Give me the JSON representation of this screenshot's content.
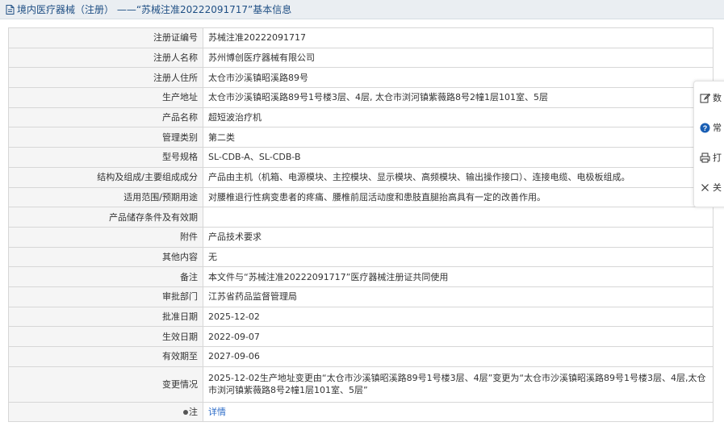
{
  "header": {
    "title": "境内医疗器械（注册） ——“苏械注准20222091717”基本信息"
  },
  "rows": [
    {
      "label": "注册证编号",
      "value": "苏械注准20222091717"
    },
    {
      "label": "注册人名称",
      "value": "苏州博创医疗器械有限公司"
    },
    {
      "label": "注册人住所",
      "value": "太仓市沙溪镇昭溪路89号"
    },
    {
      "label": "生产地址",
      "value": "太仓市沙溪镇昭溪路89号1号楼3层、4层, 太仓市浏河镇紫薇路8号2幢1层101室、5层"
    },
    {
      "label": "产品名称",
      "value": "超短波治疗机"
    },
    {
      "label": "管理类别",
      "value": "第二类"
    },
    {
      "label": "型号规格",
      "value": "SL-CDB-A、SL-CDB-B"
    },
    {
      "label": "结构及组成/主要组成成分",
      "value": "产品由主机（机箱、电源模块、主控模块、显示模块、高频模块、输出操作接口）、连接电缆、电极板组成。"
    },
    {
      "label": "适用范围/预期用途",
      "value": "对腰椎退行性病变患者的疼痛、腰椎前屈活动度和患肢直腿抬高具有一定的改善作用。"
    },
    {
      "label": "产品储存条件及有效期",
      "value": ""
    },
    {
      "label": "附件",
      "value": "产品技术要求"
    },
    {
      "label": "其他内容",
      "value": "无"
    },
    {
      "label": "备注",
      "value": "本文件与“苏械注准20222091717”医疗器械注册证共同使用"
    },
    {
      "label": "审批部门",
      "value": "江苏省药品监督管理局"
    },
    {
      "label": "批准日期",
      "value": "2025-12-02"
    },
    {
      "label": "生效日期",
      "value": "2022-09-07"
    },
    {
      "label": "有效期至",
      "value": "2027-09-06"
    },
    {
      "label": "变更情况",
      "value": "2025-12-02生产地址变更由“太仓市沙溪镇昭溪路89号1号楼3层、4层”变更为“太仓市沙溪镇昭溪路89号1号楼3层、4层,太仓市浏河镇紫薇路8号2幢1层101室、5层”"
    },
    {
      "label": "注",
      "value": "详情"
    }
  ],
  "float_panel": {
    "items": [
      {
        "label": "数",
        "icon": "edit-icon"
      },
      {
        "label": "常",
        "icon": "help-circle-icon"
      },
      {
        "label": "打",
        "icon": "print-icon"
      },
      {
        "label": "关",
        "icon": "close-icon"
      }
    ]
  },
  "colors": {
    "header_bg": "#eaeef2",
    "title_text": "#1f4f84",
    "label_bg": "#f5f5f5",
    "border": "#d7d7d7",
    "link": "#2d6cc8",
    "icon_blue": "#1a5fb4"
  }
}
